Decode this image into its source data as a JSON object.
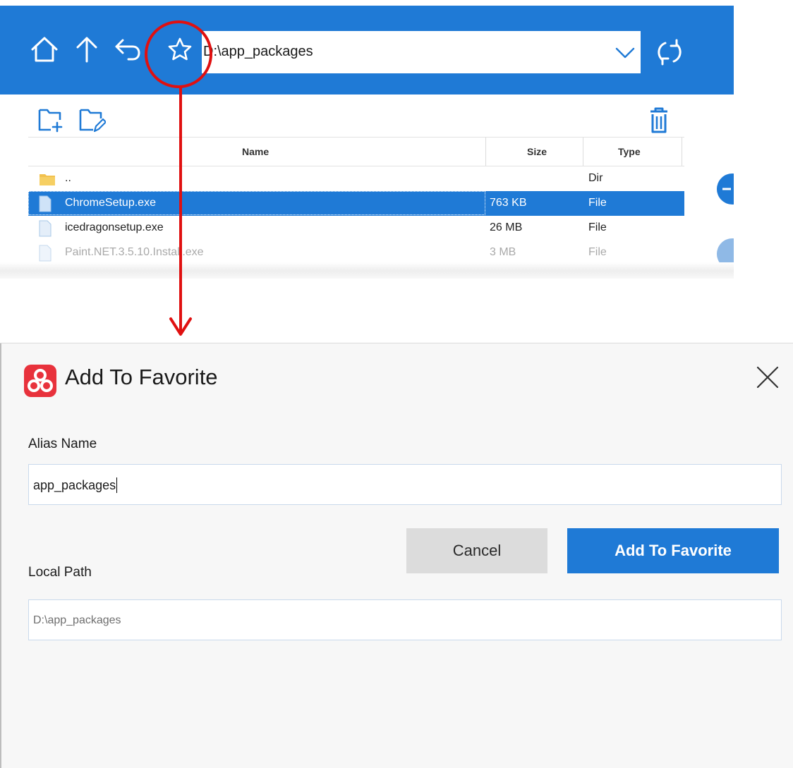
{
  "file_manager": {
    "path": "D:\\app_packages",
    "table": {
      "columns": [
        "Name",
        "Size",
        "Type"
      ],
      "rows": [
        {
          "name": "..",
          "size": "",
          "type": "Dir",
          "icon": "folder-icon",
          "selected": false
        },
        {
          "name": "ChromeSetup.exe",
          "size": "763 KB",
          "type": "File",
          "icon": "file-icon",
          "selected": true
        },
        {
          "name": "icedragonsetup.exe",
          "size": "26 MB",
          "type": "File",
          "icon": "file-icon",
          "selected": false
        },
        {
          "name": "Paint.NET.3.5.10.Install.exe",
          "size": "3 MB",
          "type": "File",
          "icon": "file-icon",
          "selected": false
        }
      ]
    },
    "icons": [
      "home-icon",
      "up-arrow-icon",
      "back-icon",
      "star-icon",
      "chevron-down-icon",
      "refresh-icon",
      "new-folder-icon",
      "rename-icon",
      "trash-icon"
    ]
  },
  "dialog": {
    "title": "Add To Favorite",
    "alias_label": "Alias Name",
    "alias_value": "app_packages",
    "path_label": "Local Path",
    "path_value": "D:\\app_packages",
    "cancel_label": "Cancel",
    "submit_label": "Add To Favorite"
  },
  "colors": {
    "accent": "#1f7ad6",
    "annotation": "#e01010",
    "logo": "#e8323c"
  }
}
